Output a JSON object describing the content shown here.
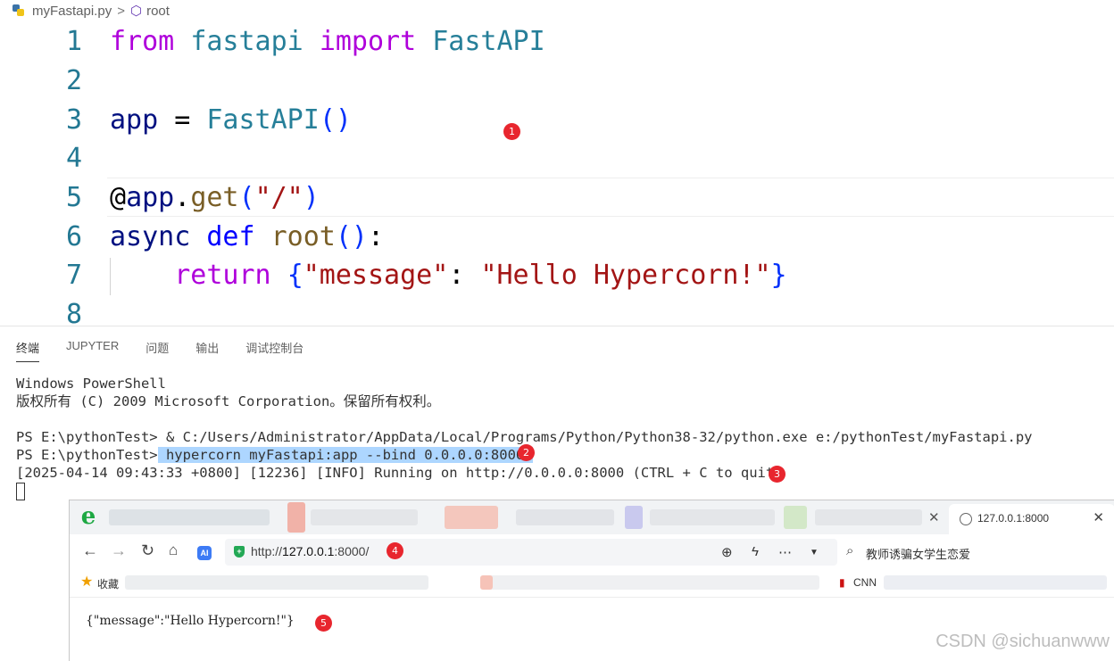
{
  "breadcrumb": {
    "file": "myFastapi.py",
    "separator": ">",
    "symbol": "root"
  },
  "editor": {
    "line_numbers": [
      "1",
      "2",
      "3",
      "4",
      "5",
      "6",
      "7",
      "8"
    ]
  },
  "panel": {
    "tabs": [
      "终端",
      "JUPYTER",
      "问题",
      "输出",
      "调试控制台"
    ],
    "active_tab": "终端"
  },
  "terminal": {
    "line1": "Windows PowerShell",
    "line2": "版权所有 (C) 2009 Microsoft Corporation。保留所有权利。",
    "line3": "PS E:\\pythonTest> & C:/Users/Administrator/AppData/Local/Programs/Python/Python38-32/python.exe e:/pythonTest/myFastapi.py",
    "line4_prompt": "PS E:\\pythonTest>",
    "line4_cmd": " hypercorn myFastapi:app --bind 0.0.0.0:8000 ",
    "line5": "[2025-04-14 09:43:33 +0800] [12236] [INFO] Running on http://0.0.0.0:8000 (CTRL + C to quit)"
  },
  "badges": [
    "1",
    "2",
    "3",
    "4",
    "5"
  ],
  "browser": {
    "active_tab_title": "127.0.0.1:8000",
    "url_prefix": "http://",
    "url_host": "127.0.0.1",
    "url_suffix": ":8000/",
    "search_query": "教师诱骗女学生恋爱",
    "bookmark_favorites": "收藏",
    "bookmark_cnn": "CNN",
    "ai_label": "AI",
    "response_body": "{\"message\":\"Hello Hypercorn!\"}"
  },
  "watermark": "CSDN @sichuanwww",
  "colors": {
    "badge": "#e8262e",
    "keyword": "#af00db",
    "class": "#267f99",
    "string": "#a31515",
    "selection": "#add6ff"
  }
}
